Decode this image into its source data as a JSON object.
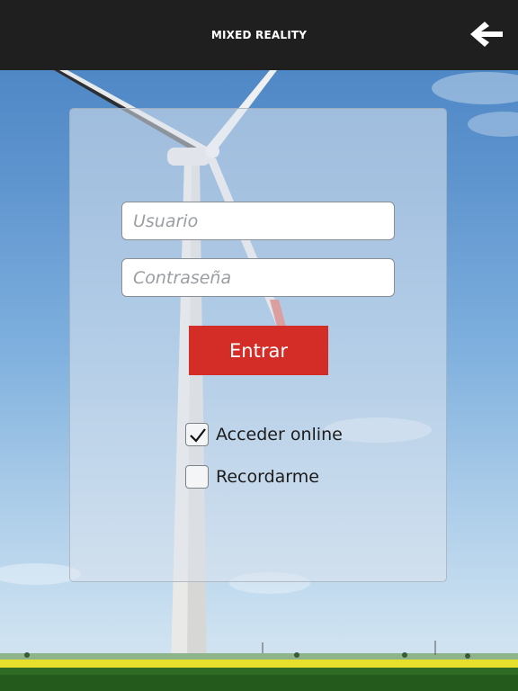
{
  "header": {
    "title": "MIXED REALITY",
    "back_icon": "arrow-left-icon"
  },
  "login": {
    "username_placeholder": "Usuario",
    "password_placeholder": "Contraseña",
    "submit_label": "Entrar",
    "options": [
      {
        "label": "Acceder online",
        "checked": true
      },
      {
        "label": "Recordarme",
        "checked": false
      }
    ]
  },
  "colors": {
    "topbar": "#1f1f1f",
    "accent": "#d42c26"
  }
}
